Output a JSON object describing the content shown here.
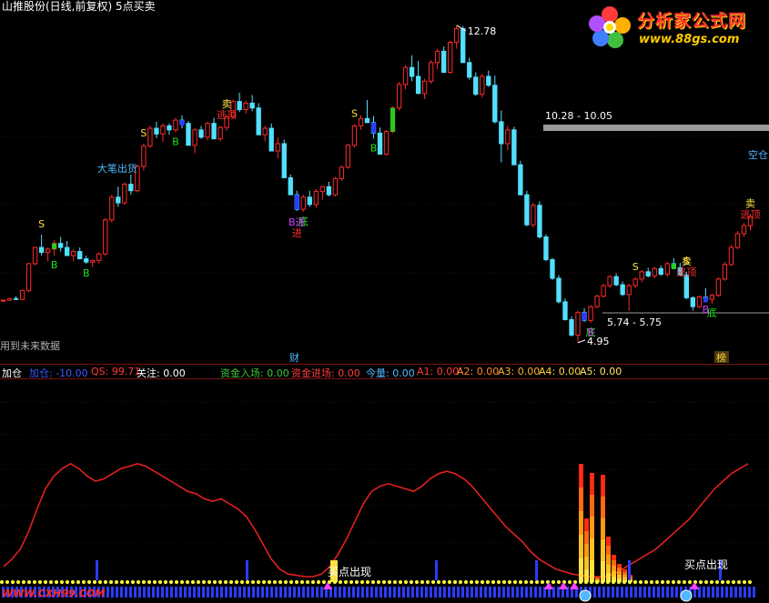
{
  "header": {
    "title": "山推股份(日线,前复权) 5点买卖"
  },
  "logo": {
    "text": "分析家公式网",
    "url": "www.88gs.com"
  },
  "watermark": "WWW.CXH99.COM",
  "indicator": {
    "name": "加仓",
    "items": [
      "加仓: -10.00",
      "QS: 99.71",
      "关注: 0.00",
      "资金入场: 0.00",
      "资金进场: 0.00",
      "今量: 0.00",
      "A1: 0.00",
      "A2: 0.00",
      "A3: 0.00",
      "A4: 0.00",
      "A5: 0.00"
    ]
  },
  "colors": {
    "up": "#ff2a2a",
    "down": "#52e0ff",
    "line": "#e02020",
    "buy_b": "#2a3cff",
    "green": "#20d020"
  },
  "chart_data": [
    {
      "type": "candlestick",
      "title": "山推股份(日线,前复权) 5点买卖",
      "candles": [
        [
          5.98,
          6.02,
          5.96,
          6.0
        ],
        [
          6.0,
          6.06,
          5.98,
          6.04
        ],
        [
          6.04,
          6.1,
          6.0,
          6.02
        ],
        [
          6.02,
          6.26,
          6.0,
          6.24
        ],
        [
          6.24,
          6.92,
          6.2,
          6.9
        ],
        [
          6.9,
          7.32,
          6.86,
          7.3
        ],
        [
          7.3,
          7.62,
          7.1,
          7.18
        ],
        [
          7.18,
          7.3,
          6.96,
          7.26
        ],
        [
          7.26,
          7.48,
          7.1,
          7.4
        ],
        [
          7.4,
          7.56,
          7.2,
          7.3
        ],
        [
          7.3,
          7.46,
          7.18,
          7.1
        ],
        [
          7.1,
          7.26,
          6.96,
          7.2
        ],
        [
          7.2,
          7.3,
          7.06,
          7.02
        ],
        [
          7.02,
          7.1,
          6.9,
          6.94
        ],
        [
          6.94,
          7.0,
          6.82,
          6.98
        ],
        [
          6.98,
          7.18,
          6.9,
          7.14
        ],
        [
          7.14,
          8.02,
          7.1,
          7.98
        ],
        [
          7.98,
          8.6,
          7.92,
          8.54
        ],
        [
          8.54,
          8.8,
          8.3,
          8.4
        ],
        [
          8.4,
          8.9,
          8.36,
          8.86
        ],
        [
          8.86,
          9.1,
          8.6,
          8.7
        ],
        [
          8.7,
          9.34,
          8.66,
          9.3
        ],
        [
          9.3,
          9.86,
          9.2,
          9.8
        ],
        [
          9.8,
          10.3,
          9.76,
          10.24
        ],
        [
          10.24,
          10.4,
          10.0,
          10.1
        ],
        [
          10.1,
          10.36,
          9.9,
          10.3
        ],
        [
          10.3,
          10.36,
          10.08,
          10.2
        ],
        [
          10.2,
          10.5,
          10.14,
          10.44
        ],
        [
          10.44,
          10.56,
          10.24,
          10.36
        ],
        [
          10.36,
          10.42,
          9.9,
          9.82
        ],
        [
          9.82,
          10.24,
          9.62,
          10.2
        ],
        [
          10.2,
          10.3,
          9.98,
          10.02
        ],
        [
          10.02,
          10.4,
          9.94,
          10.36
        ],
        [
          10.36,
          10.5,
          10.04,
          9.98
        ],
        [
          9.98,
          10.3,
          9.92,
          10.26
        ],
        [
          10.26,
          10.58,
          10.18,
          10.52
        ],
        [
          10.52,
          10.94,
          10.48,
          10.9
        ],
        [
          10.9,
          11.12,
          10.64,
          10.7
        ],
        [
          10.7,
          10.92,
          10.6,
          10.86
        ],
        [
          10.86,
          11.06,
          10.66,
          10.74
        ],
        [
          10.74,
          10.86,
          10.16,
          10.08
        ],
        [
          10.08,
          10.3,
          9.92,
          10.24
        ],
        [
          10.24,
          10.36,
          9.74,
          9.68
        ],
        [
          9.68,
          10.02,
          9.5,
          9.86
        ],
        [
          9.86,
          9.96,
          9.08,
          9.02
        ],
        [
          9.02,
          9.1,
          8.64,
          8.6
        ],
        [
          8.6,
          8.7,
          8.2,
          8.24
        ],
        [
          8.24,
          8.6,
          8.18,
          8.54
        ],
        [
          8.54,
          8.7,
          8.3,
          8.36
        ],
        [
          8.36,
          8.74,
          8.28,
          8.68
        ],
        [
          8.68,
          8.82,
          8.48,
          8.8
        ],
        [
          8.8,
          8.92,
          8.56,
          8.6
        ],
        [
          8.6,
          9.04,
          8.56,
          9.0
        ],
        [
          9.0,
          9.32,
          8.94,
          9.28
        ],
        [
          9.28,
          9.86,
          9.24,
          9.82
        ],
        [
          9.82,
          10.34,
          9.76,
          10.3
        ],
        [
          10.3,
          10.56,
          10.2,
          10.48
        ],
        [
          10.48,
          10.94,
          10.4,
          10.38
        ],
        [
          10.38,
          10.54,
          9.98,
          10.12
        ],
        [
          10.12,
          10.26,
          9.62,
          9.6
        ],
        [
          9.6,
          10.2,
          9.56,
          10.16
        ],
        [
          10.16,
          10.78,
          10.12,
          10.74
        ],
        [
          10.74,
          11.38,
          10.68,
          11.32
        ],
        [
          11.32,
          11.8,
          11.2,
          11.74
        ],
        [
          11.74,
          12.04,
          11.4,
          11.52
        ],
        [
          11.52,
          11.9,
          11.08,
          11.1
        ],
        [
          11.1,
          11.46,
          10.96,
          11.4
        ],
        [
          11.4,
          11.92,
          11.34,
          11.86
        ],
        [
          11.86,
          12.2,
          11.7,
          12.14
        ],
        [
          12.14,
          12.26,
          11.66,
          11.62
        ],
        [
          11.62,
          12.4,
          11.58,
          12.36
        ],
        [
          12.36,
          12.78,
          12.2,
          12.7
        ],
        [
          12.7,
          12.76,
          11.9,
          11.86
        ],
        [
          11.86,
          11.98,
          11.44,
          11.5
        ],
        [
          11.5,
          11.62,
          11.04,
          11.08
        ],
        [
          11.08,
          11.58,
          11.0,
          11.52
        ],
        [
          11.52,
          11.66,
          11.26,
          11.3
        ],
        [
          11.3,
          11.54,
          10.36,
          10.4
        ],
        [
          10.4,
          10.68,
          9.4,
          9.86
        ],
        [
          9.86,
          10.3,
          9.7,
          10.2
        ],
        [
          10.2,
          10.28,
          9.38,
          9.34
        ],
        [
          9.34,
          9.44,
          8.58,
          8.6
        ],
        [
          8.6,
          8.7,
          7.82,
          7.86
        ],
        [
          7.86,
          8.4,
          7.8,
          8.34
        ],
        [
          8.34,
          8.44,
          7.52,
          7.56
        ],
        [
          7.56,
          7.62,
          6.96,
          7.0
        ],
        [
          7.0,
          7.04,
          6.5,
          6.54
        ],
        [
          6.54,
          6.62,
          5.92,
          5.96
        ],
        [
          5.96,
          6.04,
          5.5,
          5.52
        ],
        [
          5.52,
          5.6,
          5.1,
          5.14
        ],
        [
          5.14,
          5.74,
          4.95,
          5.7
        ],
        [
          5.7,
          5.8,
          5.46,
          5.5
        ],
        [
          5.5,
          5.88,
          5.44,
          5.84
        ],
        [
          5.84,
          6.14,
          5.8,
          6.1
        ],
        [
          6.1,
          6.4,
          6.06,
          6.36
        ],
        [
          6.36,
          6.62,
          6.3,
          6.58
        ],
        [
          6.58,
          6.66,
          6.34,
          6.38
        ],
        [
          6.38,
          6.46,
          6.1,
          6.14
        ],
        [
          6.14,
          6.4,
          5.74,
          6.36
        ],
        [
          6.36,
          6.56,
          6.3,
          6.52
        ],
        [
          6.52,
          6.74,
          6.44,
          6.7
        ],
        [
          6.7,
          6.8,
          6.56,
          6.6
        ],
        [
          6.6,
          6.82,
          6.54,
          6.78
        ],
        [
          6.78,
          6.86,
          6.6,
          6.64
        ],
        [
          6.64,
          6.94,
          6.58,
          6.9
        ],
        [
          6.9,
          7.04,
          6.76,
          6.8
        ],
        [
          6.8,
          6.92,
          6.6,
          6.62
        ],
        [
          6.62,
          6.7,
          6.02,
          6.06
        ],
        [
          6.06,
          6.1,
          5.74,
          5.84
        ],
        [
          5.84,
          6.12,
          5.8,
          6.08
        ],
        [
          6.08,
          6.3,
          6.0,
          6.02
        ],
        [
          6.02,
          6.16,
          5.92,
          6.12
        ],
        [
          6.12,
          6.56,
          6.08,
          6.52
        ],
        [
          6.52,
          6.94,
          6.48,
          6.88
        ],
        [
          6.88,
          7.36,
          6.84,
          7.3
        ],
        [
          7.3,
          7.7,
          7.26,
          7.64
        ],
        [
          7.64,
          7.9,
          7.56,
          7.84
        ],
        [
          7.84,
          8.12,
          7.72,
          8.06
        ]
      ],
      "ylim": [
        4.7,
        13.0
      ],
      "annotations": {
        "high": "12.78",
        "low": "4.95",
        "range_upper": "10.28 - 10.05",
        "range_lower": "5.74 - 5.75",
        "labels": [
          {
            "bar": 6,
            "text": "S",
            "color": "#ffe040"
          },
          {
            "bar": 8,
            "text": "B",
            "color": "#20e020"
          },
          {
            "bar": 13,
            "text": "B",
            "color": "#20e020"
          },
          {
            "bar": 22,
            "text": "S",
            "color": "#ffe040"
          },
          {
            "bar": 21,
            "text": "大笔出货",
            "color": "#50b8ff"
          },
          {
            "bar": 27,
            "text": "B",
            "color": "#20e020"
          },
          {
            "bar": 35,
            "text": "卖",
            "color": "#ffe040"
          },
          {
            "bar": 35,
            "text": "逃顶",
            "color": "#ff3030"
          },
          {
            "bar": 47,
            "text": "底",
            "color": "#20e020"
          },
          {
            "bar": 46,
            "text": "B进",
            "color": "#d040ff"
          },
          {
            "bar": 46,
            "text": "进",
            "color": "#ff3030"
          },
          {
            "bar": 55,
            "text": "S",
            "color": "#ffe040"
          },
          {
            "bar": 58,
            "text": "B",
            "color": "#20e020"
          },
          {
            "bar": 92,
            "text": "底",
            "color": "#20e020"
          },
          {
            "bar": 92,
            "text": "B",
            "color": "#d040ff"
          },
          {
            "bar": 99,
            "text": "S",
            "color": "#ffe040"
          },
          {
            "bar": 107,
            "text": "S",
            "color": "#ffe040"
          },
          {
            "bar": 107,
            "text": "卖",
            "color": "#ffe040"
          },
          {
            "bar": 107,
            "text": "逃顶",
            "color": "#ff3030"
          },
          {
            "bar": 111,
            "text": "底",
            "color": "#20e020"
          },
          {
            "bar": 110,
            "text": "B",
            "color": "#d040ff"
          },
          {
            "bar": 118,
            "text": "卖",
            "color": "#ffe040"
          },
          {
            "bar": 118,
            "text": "逃顶",
            "color": "#ff3030"
          },
          {
            "bar": 118,
            "text": "空仓",
            "color": "#50b8ff"
          }
        ],
        "bottom_left": "用到未来数据",
        "event_cai": "财",
        "event_bang": "榜"
      }
    },
    {
      "type": "line",
      "title": "加仓",
      "series": [
        {
          "name": "QS",
          "values": [
            8,
            14,
            22,
            36,
            54,
            70,
            80,
            86,
            90,
            86,
            80,
            76,
            78,
            82,
            86,
            88,
            90,
            88,
            84,
            80,
            76,
            72,
            68,
            66,
            62,
            60,
            62,
            58,
            54,
            48,
            38,
            26,
            14,
            6,
            2,
            1,
            0,
            0,
            2,
            8,
            18,
            30,
            44,
            58,
            68,
            72,
            74,
            72,
            70,
            68,
            72,
            78,
            82,
            84,
            82,
            78,
            72,
            64,
            56,
            48,
            40,
            34,
            28,
            20,
            14,
            10,
            6,
            4,
            2,
            1,
            0,
            0,
            0,
            2,
            6,
            10,
            14,
            18,
            22,
            28,
            34,
            40,
            46,
            54,
            62,
            70,
            76,
            82,
            86,
            90
          ]
        }
      ],
      "ylim": [
        0,
        100
      ],
      "annotations": {
        "buy_signal": "买点出现"
      }
    }
  ]
}
